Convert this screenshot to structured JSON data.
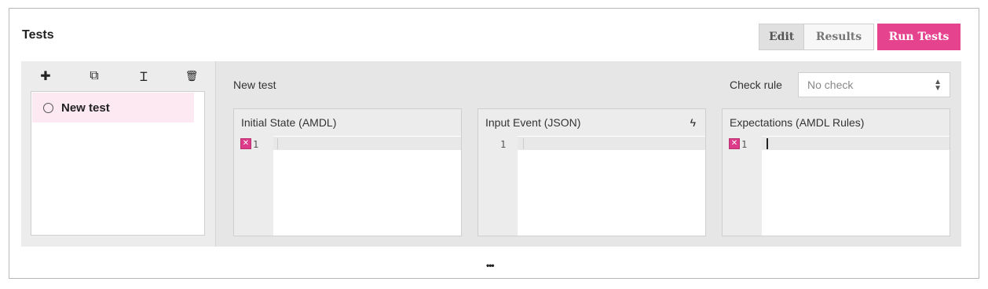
{
  "header": {
    "title": "Tests"
  },
  "toolbar": {
    "edit_label": "Edit",
    "results_label": "Results",
    "run_label": "Run Tests"
  },
  "sidebar": {
    "tools": [
      {
        "icon": "plus-icon",
        "glyph": "✚"
      },
      {
        "icon": "duplicate-icon",
        "glyph": "⧉"
      },
      {
        "icon": "text-cursor-icon",
        "glyph": "Ɪ"
      },
      {
        "icon": "trash-icon",
        "glyph": "🗑"
      }
    ],
    "items": [
      {
        "label": "New test",
        "selected": true
      }
    ]
  },
  "main": {
    "test_name": "New test",
    "check_rule": {
      "label": "Check rule",
      "placeholder": "No check"
    },
    "editors": [
      {
        "title": "Initial State (AMDL)",
        "line": "1",
        "has_error": true
      },
      {
        "title": "Input Event (JSON)",
        "line": "1",
        "has_error": false,
        "action_icon": "lightning-icon"
      },
      {
        "title": "Expectations (AMDL Rules)",
        "line": "1",
        "has_error": true
      }
    ]
  },
  "footer": {
    "more_label": "•••"
  },
  "colors": {
    "accent": "#e6438f",
    "selected_row": "#fde9f1",
    "panel": "#e6e6e6"
  }
}
